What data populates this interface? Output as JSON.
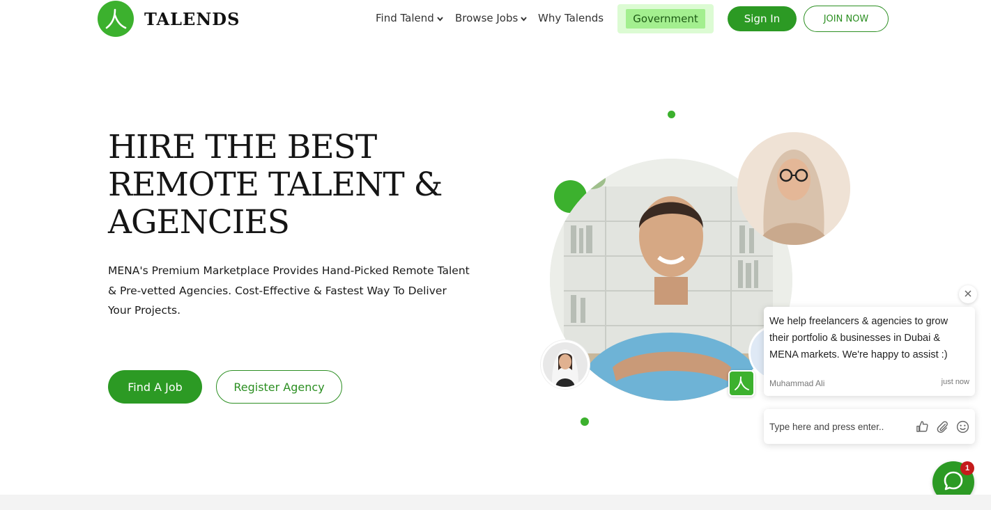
{
  "brand": {
    "name": "TALENDS",
    "accent_color": "#3cb12e",
    "dark_green": "#2c9a24"
  },
  "nav": {
    "find_talend": "Find Talend",
    "browse_jobs": "Browse Jobs",
    "why_talends": "Why Talends",
    "government": "Government",
    "sign_in": "Sign In",
    "join_now": "JOIN NOW"
  },
  "hero": {
    "title_line1": "HIRE THE BEST",
    "title_line2": "REMOTE TALENT &",
    "title_line3": "AGENCIES",
    "subtitle": "MENA's Premium Marketplace Provides Hand-Picked Remote Talent & Pre-vetted Agencies. Cost-Effective & Fastest Way To Deliver Your Projects.",
    "find_job": "Find A Job",
    "register_agency": "Register Agency"
  },
  "chat": {
    "message": "We help freelancers & agencies to grow their portfolio & businesses in Dubai & MENA markets. We're happy to assist :)",
    "author": "Muhammad Ali",
    "time": "just now",
    "input_placeholder": "Type here and press enter..",
    "unread_count": "1"
  }
}
